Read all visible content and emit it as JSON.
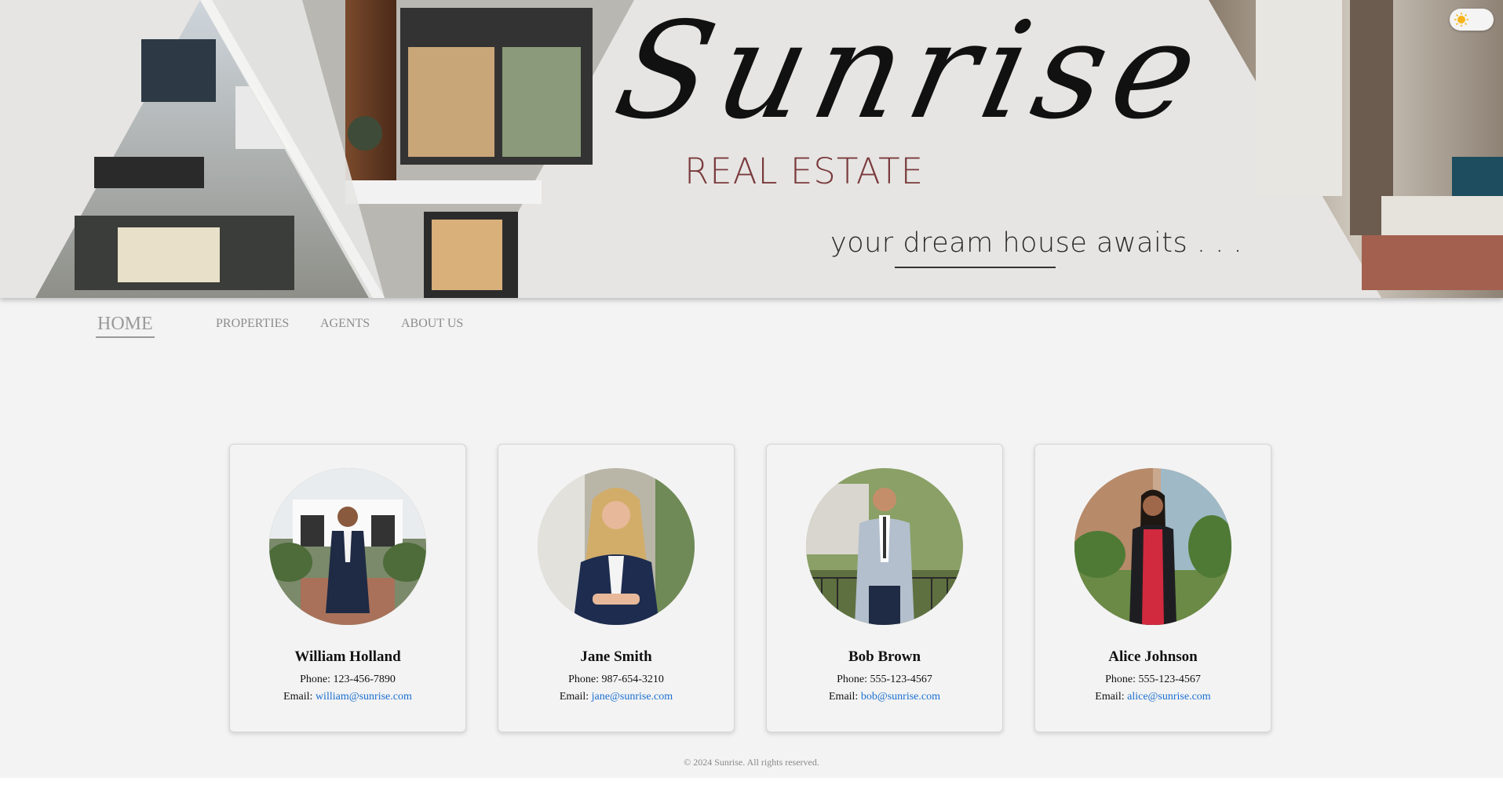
{
  "hero": {
    "brand": "Sunrise",
    "subtitle": "REAL ESTATE",
    "tagline": "your dream house awaits . . .",
    "theme_toggle_icon": "sun-icon"
  },
  "nav": {
    "items": [
      {
        "label": "HOME",
        "active": true
      },
      {
        "label": "PROPERTIES",
        "active": false
      },
      {
        "label": "AGENTS",
        "active": false
      },
      {
        "label": "ABOUT US",
        "active": false
      }
    ]
  },
  "agents": [
    {
      "name": "William Holland",
      "phone_label": "Phone:",
      "phone": "123-456-7890",
      "email_label": "Email:",
      "email": "william@sunrise.com"
    },
    {
      "name": "Jane Smith",
      "phone_label": "Phone:",
      "phone": "987-654-3210",
      "email_label": "Email:",
      "email": "jane@sunrise.com"
    },
    {
      "name": "Bob Brown",
      "phone_label": "Phone:",
      "phone": "555-123-4567",
      "email_label": "Email:",
      "email": "bob@sunrise.com"
    },
    {
      "name": "Alice Johnson",
      "phone_label": "Phone:",
      "phone": "555-123-4567",
      "email_label": "Email:",
      "email": "alice@sunrise.com"
    }
  ],
  "footer": {
    "text": "© 2024 Sunrise. All rights reserved."
  },
  "colors": {
    "subtitle": "#7a3a3c",
    "link": "#1a6fd1",
    "hero_bg": "#e6e5e3",
    "page_bg": "#f3f3f3"
  }
}
